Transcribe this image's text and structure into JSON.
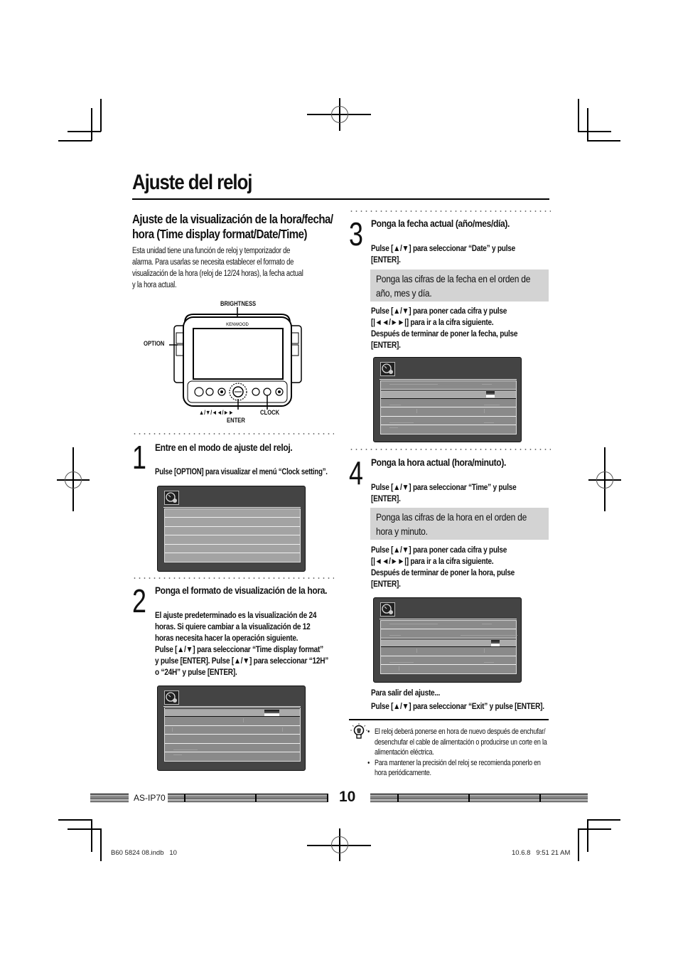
{
  "page": {
    "title": "Ajuste del reloj",
    "section_title_line1": "Ajuste de la visualización de la hora/fecha/",
    "section_title_line2": "hora (Time display format/Date/Time)",
    "intro": [
      "Esta unidad tiene una función de reloj y temporizador de",
      "alarma. Para usarlas se necesita establecer el formato de",
      "visualización de la hora (reloj de 12/24 horas), la fecha actual",
      "y la hora actual."
    ]
  },
  "device": {
    "brand": "KENWOOD",
    "labels": {
      "brightness": "BRIGHTNESS",
      "option": "OPTION",
      "arrows": "▲/▼/◄◄/►►",
      "enter": "ENTER",
      "clock": "CLOCK"
    }
  },
  "steps": [
    {
      "number": "1",
      "heading": "Entre en el modo de ajuste del reloj.",
      "text": [
        "Pulse [OPTION] para visualizar el menú “Clock setting”."
      ]
    },
    {
      "number": "2",
      "heading": "Ponga el formato de visualización de la hora.",
      "text": [
        "El ajuste predeterminado es la visualización de 24",
        "horas. Si quiere cambiar a la visualización de 12",
        "horas necesita hacer la operación siguiente.",
        "Pulse [▲/▼] para seleccionar “Time display format”",
        "y pulse [ENTER]. Pulse [▲/▼] para seleccionar “12H”",
        "o “24H” y pulse [ENTER]."
      ]
    },
    {
      "number": "3",
      "heading": "Ponga la fecha actual (año/mes/día).",
      "text": [
        "Pulse [▲/▼] para seleccionar “Date” y pulse",
        "[ENTER]."
      ],
      "note": [
        "Ponga las cifras de la fecha en el orden de",
        "año, mes y día."
      ],
      "text2": [
        "Pulse [▲/▼] para poner cada cifra y pulse",
        "[|◄◄/►►|] para ir a la cifra siguiente.",
        "Después de terminar de poner la fecha, pulse",
        "[ENTER]."
      ]
    },
    {
      "number": "4",
      "heading": "Ponga la hora actual (hora/minuto).",
      "text": [
        "Pulse [▲/▼] para seleccionar “Time” y pulse",
        "[ENTER]."
      ],
      "note": [
        "Ponga las cifras de la hora en el orden de",
        "hora y minuto."
      ],
      "text2": [
        "Pulse [▲/▼] para poner cada cifra y pulse",
        "[|◄◄/►►|] para ir a la cifra siguiente.",
        "Después de terminar de poner la hora, pulse",
        "[ENTER]."
      ]
    }
  ],
  "exit": {
    "heading": "Para salir del ajuste...",
    "text": "Pulse [▲/▼] para seleccionar “Exit” y pulse [ENTER]."
  },
  "tips": {
    "icon": "lightbulb-icon",
    "items": [
      "El reloj deberá ponerse en hora de nuevo después de enchufar/ desenchufar el cable de alimentación o producirse un corte en la alimentación eléctrica.",
      "Para mantener la precisión del reloj se recomienda ponerlo en hora periódicamente."
    ]
  },
  "footer": {
    "model": "AS-IP70",
    "page_number": "10",
    "file": "B60 5824 08.indb   10",
    "timestamp": "10.6.8   9:51 21 AM"
  },
  "screens": {
    "icon": "clock-setting-icon",
    "step1_rows": 6,
    "step2_selected_row": 1,
    "step3_selected_row": 2,
    "step4_selected_row": 3
  }
}
